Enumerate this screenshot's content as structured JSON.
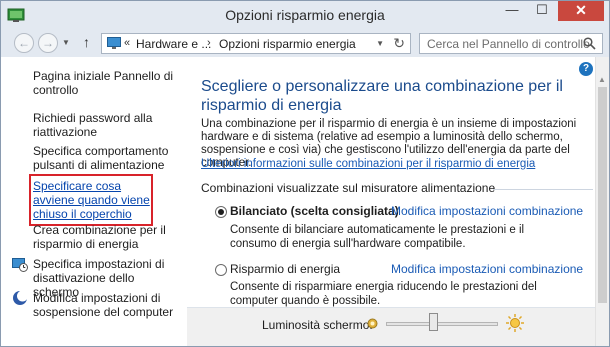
{
  "window": {
    "title": "Opzioni risparmio energia",
    "minimize_label": "—",
    "maximize_label": "☐",
    "close_label": "✕"
  },
  "nav": {
    "back_label": "←",
    "forward_label": "→",
    "up_label": "↑",
    "refresh_label": "↻",
    "breadcrumb": [
      {
        "label": "Hardware e ..."
      },
      {
        "label": "Opzioni risparmio energia"
      }
    ],
    "breadcrumb_root_glyph": "«",
    "breadcrumb_sep_glyph": "›",
    "search_placeholder": "Cerca nel Pannello di controllo"
  },
  "sidebar": {
    "items": [
      {
        "label": "Pagina iniziale Pannello di controllo",
        "icon": null
      },
      {
        "label": "Richiedi password alla riattivazione",
        "icon": null
      },
      {
        "label": "Specifica comportamento pulsanti di alimentazione",
        "icon": null
      },
      {
        "label": "Specificare cosa avviene quando viene chiuso il coperchio",
        "icon": null,
        "highlighted": true
      },
      {
        "label": "Crea combinazione per il risparmio di energia",
        "icon": null
      },
      {
        "label": "Specifica impostazioni di disattivazione dello schermo",
        "icon": "monitor-clock-icon"
      },
      {
        "label": "Modifica impostazioni di sospensione del computer",
        "icon": "moon-icon"
      }
    ]
  },
  "main": {
    "title": "Scegliere o personalizzare una combinazione per il risparmio di energia",
    "intro": "Una combinazione per il risparmio di energia è un insieme di impostazioni hardware e di sistema (relative ad esempio a luminosità dello schermo, sospensione e così via) che gestiscono l'utilizzo dell'energia da parte del computer.",
    "info_link": "Ulteriori informazioni sulle combinazioni per il risparmio di energia",
    "group_header": "Combinazioni visualizzate sul misuratore alimentazione",
    "plans": [
      {
        "name": "Bilanciato (scelta consigliata)",
        "selected": true,
        "link": "Modifica impostazioni combinazione",
        "description": "Consente di bilanciare automaticamente le prestazioni e il consumo di energia sull'hardware compatibile."
      },
      {
        "name": "Risparmio di energia",
        "selected": false,
        "link": "Modifica impostazioni combinazione",
        "description": "Consente di risparmiare energia riducendo le prestazioni del computer quando è possibile."
      }
    ],
    "help_label": "?"
  },
  "bottom": {
    "brightness_label": "Luminosità schermo:",
    "brightness_level": 0.42
  },
  "colors": {
    "title_blue": "#1b4b8c",
    "link_blue": "#1a5bb5",
    "highlight_red": "#d8232a",
    "close_red": "#c9483e"
  }
}
